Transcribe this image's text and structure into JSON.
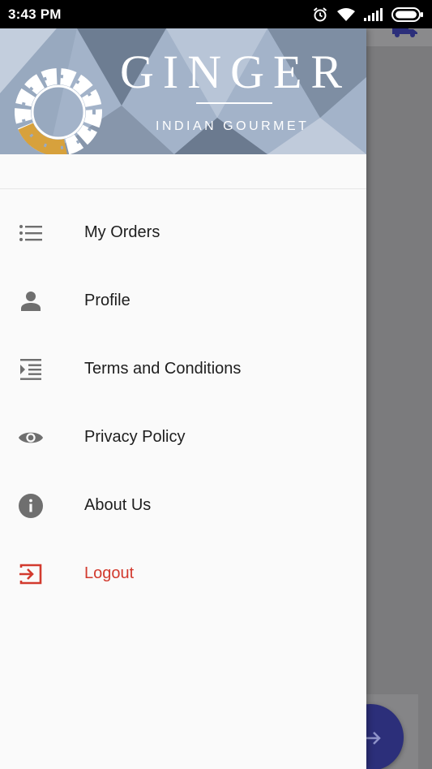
{
  "status_bar": {
    "time": "3:43 PM"
  },
  "drawer": {
    "brand": {
      "title": "GINGER",
      "subtitle": "INDIAN GOURMET"
    },
    "menu": [
      {
        "label": "My Orders",
        "icon": "list-icon"
      },
      {
        "label": "Profile",
        "icon": "person-icon"
      },
      {
        "label": "Terms and Conditions",
        "icon": "format-indent-icon"
      },
      {
        "label": "Privacy Policy",
        "icon": "eye-icon"
      },
      {
        "label": "About Us",
        "icon": "info-icon"
      },
      {
        "label": "Logout",
        "icon": "logout-icon"
      }
    ]
  },
  "colors": {
    "icon_grey": "#6f6f6f",
    "logout_red": "#d23a2e",
    "accent_navy": "#2c2f7a",
    "logo_gold": "#d7a13c"
  }
}
